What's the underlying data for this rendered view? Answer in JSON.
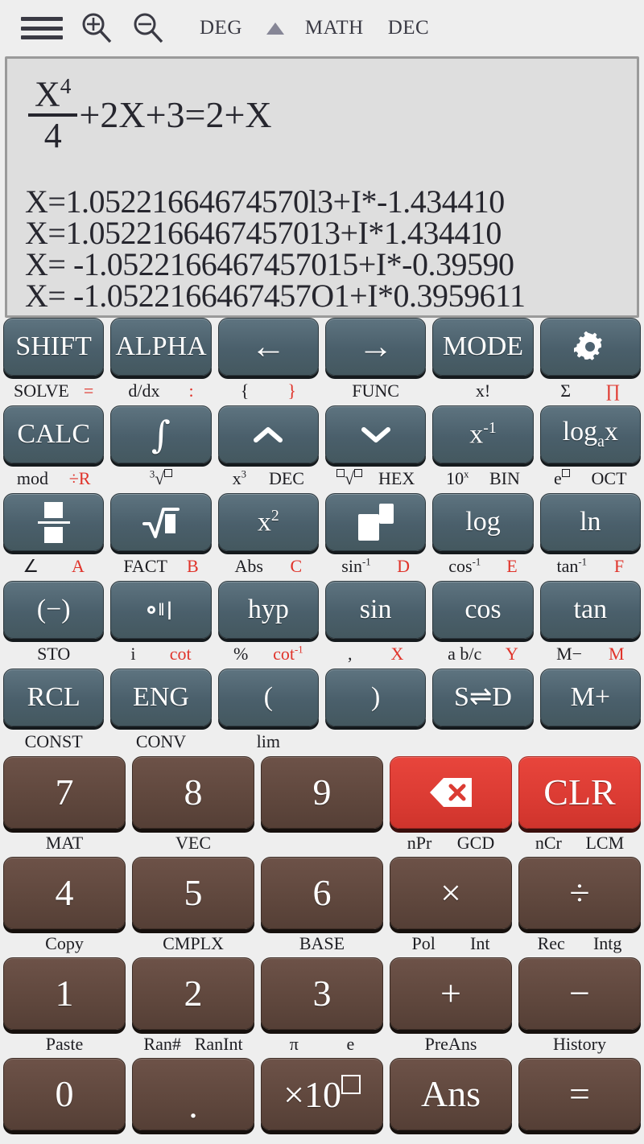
{
  "topbar": {
    "menu_icon": "hamburger-icon",
    "zoom_in_icon": "zoom-in-icon",
    "zoom_out_icon": "zoom-out-icon",
    "angle_mode": "DEG",
    "indicator_icon": "triangle-up-icon",
    "input_mode": "MATH",
    "base_mode": "DEC"
  },
  "display": {
    "expression": {
      "fraction_numerator": "X",
      "fraction_numerator_exp": "4",
      "fraction_denominator": "4",
      "rest": "+2X+3=2+X",
      "full_text": "X^4/4+2X+3=2+X"
    },
    "results": [
      "X=1.05221664674570l3+I*-1.434410",
      "X=1.0522166467457013+I*1.434410",
      "X= -1.0522166467457015+I*-0.39590",
      "X= -1.0522166467457O1+I*0.3959611"
    ]
  },
  "function_rows": [
    {
      "keys": [
        {
          "main": "SHIFT",
          "name": "shift-button",
          "shift": "SOLVE",
          "alpha": "="
        },
        {
          "main": "ALPHA",
          "name": "alpha-button",
          "shift": "d/dx",
          "alpha": ":"
        },
        {
          "main": "←",
          "name": "arrow-left-button",
          "shift": "{",
          "alpha": "}"
        },
        {
          "main": "→",
          "name": "arrow-right-button",
          "shift": "FUNC",
          "alpha": ""
        },
        {
          "main": "MODE",
          "name": "mode-button",
          "shift": "x!",
          "alpha": ""
        },
        {
          "main": "gear-icon",
          "name": "settings-button",
          "shift": "Σ",
          "alpha": "∏"
        }
      ]
    },
    {
      "keys": [
        {
          "main": "CALC",
          "name": "calc-button",
          "shift": "mod",
          "alpha": "÷R"
        },
        {
          "main": "∫",
          "name": "integral-button",
          "shift": "³√□",
          "alpha": ""
        },
        {
          "main": "^",
          "name": "arrow-up-button",
          "shift": "x³",
          "alpha": "DEC"
        },
        {
          "main": "v",
          "name": "arrow-down-button",
          "shift": "□√□",
          "alpha": "HEX"
        },
        {
          "main": "x⁻¹",
          "name": "reciprocal-button",
          "shift": "10ˣ",
          "alpha": "BIN"
        },
        {
          "main": "log_a x",
          "name": "log-base-button",
          "shift": "e□",
          "alpha": "OCT"
        }
      ]
    },
    {
      "keys": [
        {
          "main": "fraction-icon",
          "name": "fraction-button",
          "shift": "∠",
          "alpha": "A"
        },
        {
          "main": "√",
          "name": "sqrt-button",
          "shift": "FACT",
          "alpha": "B"
        },
        {
          "main": "x²",
          "name": "square-button",
          "shift": "Abs",
          "alpha": "C"
        },
        {
          "main": "power-icon",
          "name": "power-button",
          "shift": "sin⁻¹",
          "alpha": "D"
        },
        {
          "main": "log",
          "name": "log-button",
          "shift": "cos⁻¹",
          "alpha": "E"
        },
        {
          "main": "ln",
          "name": "ln-button",
          "shift": "tan⁻¹",
          "alpha": "F"
        }
      ]
    },
    {
      "keys": [
        {
          "main": "(−)",
          "name": "negative-button",
          "shift": "STO",
          "alpha": ""
        },
        {
          "main": "degree-icon",
          "name": "dms-button",
          "shift": "i",
          "alpha": "cot"
        },
        {
          "main": "hyp",
          "name": "hyp-button",
          "shift": "%",
          "alpha": "cot⁻¹"
        },
        {
          "main": "sin",
          "name": "sin-button",
          "shift": ",",
          "alpha": "X"
        },
        {
          "main": "cos",
          "name": "cos-button",
          "shift": "a b/c",
          "alpha": "Y"
        },
        {
          "main": "tan",
          "name": "tan-button",
          "shift": "M−",
          "alpha": "M"
        }
      ]
    },
    {
      "keys": [
        {
          "main": "RCL",
          "name": "rcl-button",
          "shift": "CONST",
          "alpha": ""
        },
        {
          "main": "ENG",
          "name": "eng-button",
          "shift": "CONV",
          "alpha": ""
        },
        {
          "main": "(",
          "name": "open-paren-button",
          "shift": "lim",
          "alpha": ""
        },
        {
          "main": ")",
          "name": "close-paren-button",
          "shift": "",
          "alpha": ""
        },
        {
          "main": "S⇌D",
          "name": "sd-toggle-button",
          "shift": "",
          "alpha": ""
        },
        {
          "main": "M+",
          "name": "memory-plus-button",
          "shift": "",
          "alpha": ""
        }
      ]
    }
  ],
  "number_rows": [
    {
      "keys": [
        {
          "main": "7",
          "name": "digit-7-button",
          "style": "num",
          "shift": "MAT",
          "alpha": ""
        },
        {
          "main": "8",
          "name": "digit-8-button",
          "style": "num",
          "shift": "VEC",
          "alpha": ""
        },
        {
          "main": "9",
          "name": "digit-9-button",
          "style": "num",
          "shift": "",
          "alpha": ""
        },
        {
          "main": "backspace-icon",
          "name": "delete-button",
          "style": "red",
          "shift": "nPr",
          "alpha": "GCD"
        },
        {
          "main": "CLR",
          "name": "clear-button",
          "style": "red",
          "shift": "nCr",
          "alpha": "LCM"
        }
      ]
    },
    {
      "keys": [
        {
          "main": "4",
          "name": "digit-4-button",
          "style": "num",
          "shift": "Copy",
          "alpha": ""
        },
        {
          "main": "5",
          "name": "digit-5-button",
          "style": "num",
          "shift": "CMPLX",
          "alpha": ""
        },
        {
          "main": "6",
          "name": "digit-6-button",
          "style": "num",
          "shift": "BASE",
          "alpha": ""
        },
        {
          "main": "×",
          "name": "multiply-button",
          "style": "num",
          "shift": "Pol",
          "alpha": "Int"
        },
        {
          "main": "÷",
          "name": "divide-button",
          "style": "num",
          "shift": "Rec",
          "alpha": "Intg"
        }
      ]
    },
    {
      "keys": [
        {
          "main": "1",
          "name": "digit-1-button",
          "style": "num",
          "shift": "Paste",
          "alpha": ""
        },
        {
          "main": "2",
          "name": "digit-2-button",
          "style": "num",
          "shift": "Ran#",
          "alpha": "RanInt"
        },
        {
          "main": "3",
          "name": "digit-3-button",
          "style": "num",
          "shift": "π",
          "alpha": "e"
        },
        {
          "main": "+",
          "name": "plus-button",
          "style": "num",
          "shift": "",
          "alpha": "PreAns"
        },
        {
          "main": "−",
          "name": "minus-button",
          "style": "num",
          "shift": "History",
          "alpha": ""
        }
      ]
    },
    {
      "keys": [
        {
          "main": "0",
          "name": "digit-0-button",
          "style": "num",
          "shift": "",
          "alpha": ""
        },
        {
          "main": ".",
          "name": "decimal-point-button",
          "style": "num",
          "shift": "",
          "alpha": ""
        },
        {
          "main": "×10□",
          "name": "exponent-button",
          "style": "num",
          "shift": "",
          "alpha": ""
        },
        {
          "main": "Ans",
          "name": "answer-button",
          "style": "num",
          "shift": "",
          "alpha": ""
        },
        {
          "main": "=",
          "name": "equals-button",
          "style": "num",
          "shift": "",
          "alpha": ""
        }
      ]
    }
  ],
  "colors": {
    "background": "#eeeeee",
    "display_bg": "#dedede",
    "fn_key": "#4d6270",
    "num_key": "#5f473d",
    "accent_red": "#db3b33",
    "alpha_label": "#e0332a",
    "text_dark": "#26262e"
  }
}
